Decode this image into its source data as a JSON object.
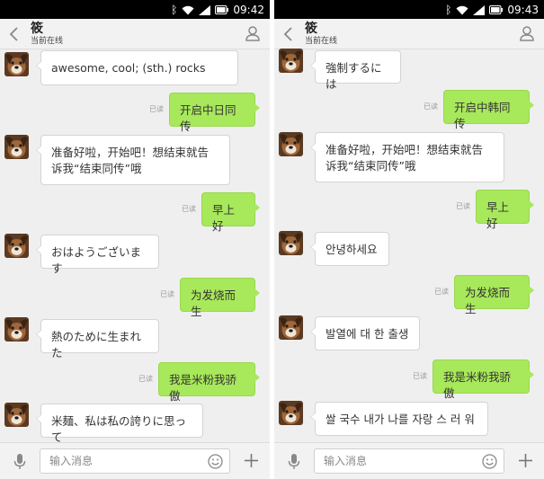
{
  "screens": [
    {
      "status_time": "09:42",
      "title": "筱",
      "subtitle": "当前在线",
      "input_placeholder": "输入消息",
      "messages": [
        {
          "side": "in",
          "text": "awesome, cool; (sth.) rocks"
        },
        {
          "side": "out",
          "text": "开启中日同传",
          "read": "已读"
        },
        {
          "side": "in",
          "text": "准备好啦，开始吧！想结束就告诉我“结束同传”哦"
        },
        {
          "side": "out",
          "text": "早上好",
          "read": "已读"
        },
        {
          "side": "in",
          "text": "おはようございます"
        },
        {
          "side": "out",
          "text": "为发烧而生",
          "read": "已读"
        },
        {
          "side": "in",
          "text": "熱のために生まれた"
        },
        {
          "side": "out",
          "text": "我是米粉我骄傲",
          "read": "已读"
        },
        {
          "side": "in",
          "text": "米麺、私は私の誇りに思って"
        }
      ]
    },
    {
      "status_time": "09:43",
      "title": "筱",
      "subtitle": "当前在线",
      "input_placeholder": "输入消息",
      "messages": [
        {
          "side": "in",
          "text": "強制するには"
        },
        {
          "side": "out",
          "text": "开启中韩同传",
          "read": "已读"
        },
        {
          "side": "in",
          "text": "准备好啦，开始吧！想结束就告诉我“结束同传”哦"
        },
        {
          "side": "out",
          "text": "早上好",
          "read": "已读"
        },
        {
          "side": "in",
          "text": "안녕하세요"
        },
        {
          "side": "out",
          "text": "为发烧而生",
          "read": "已读"
        },
        {
          "side": "in",
          "text": "발열에 대 한 출생"
        },
        {
          "side": "out",
          "text": "我是米粉我骄傲",
          "read": "已读"
        },
        {
          "side": "in",
          "text": "쌀 국수 내가 나를 자랑 스 러 워"
        }
      ]
    }
  ],
  "icons": {
    "status": [
      "bluetooth-icon",
      "wifi-icon",
      "signal-icon",
      "battery-icon"
    ],
    "header": [
      "back-arrow-icon",
      "profile-icon"
    ],
    "input": [
      "microphone-icon",
      "emoji-icon",
      "plus-icon"
    ]
  },
  "colors": {
    "background": "#efefef",
    "outgoing_bubble": "#a8e85b",
    "incoming_bubble": "#ffffff",
    "status_bar": "#000000"
  }
}
